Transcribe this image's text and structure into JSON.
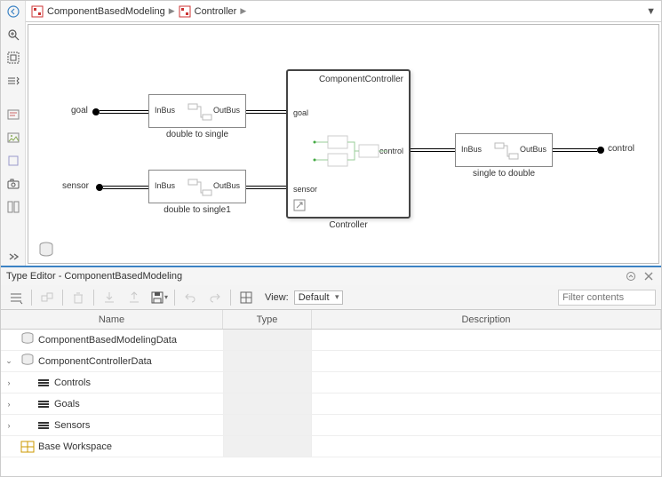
{
  "breadcrumb": {
    "root": "ComponentBasedModeling",
    "current": "Controller"
  },
  "canvas": {
    "input_goal": "goal",
    "input_sensor": "sensor",
    "output_control": "control",
    "block_d2s": {
      "in": "InBus",
      "out": "OutBus",
      "caption": "double to single"
    },
    "block_d2s1": {
      "in": "InBus",
      "out": "OutBus",
      "caption": "double to single1"
    },
    "block_s2d": {
      "in": "InBus",
      "out": "OutBus",
      "caption": "single to double"
    },
    "controller": {
      "title": "ComponentController",
      "port_goal": "goal",
      "port_sensor": "sensor",
      "port_control": "control",
      "caption": "Controller"
    }
  },
  "panel": {
    "title": "Type Editor - ComponentBasedModeling",
    "view_label": "View:",
    "view_value": "Default",
    "filter_placeholder": "Filter contents",
    "columns": {
      "name": "Name",
      "type": "Type",
      "desc": "Description"
    },
    "rows": [
      {
        "kind": "dict",
        "label": "ComponentBasedModelingData",
        "indent": 0,
        "expander": ""
      },
      {
        "kind": "dict",
        "label": "ComponentControllerData",
        "indent": 0,
        "expander": "v"
      },
      {
        "kind": "bus",
        "label": "Controls",
        "indent": 1,
        "expander": ">"
      },
      {
        "kind": "bus",
        "label": "Goals",
        "indent": 1,
        "expander": ">"
      },
      {
        "kind": "bus",
        "label": "Sensors",
        "indent": 1,
        "expander": ">"
      },
      {
        "kind": "ws",
        "label": "Base Workspace",
        "indent": 0,
        "expander": ""
      }
    ]
  }
}
